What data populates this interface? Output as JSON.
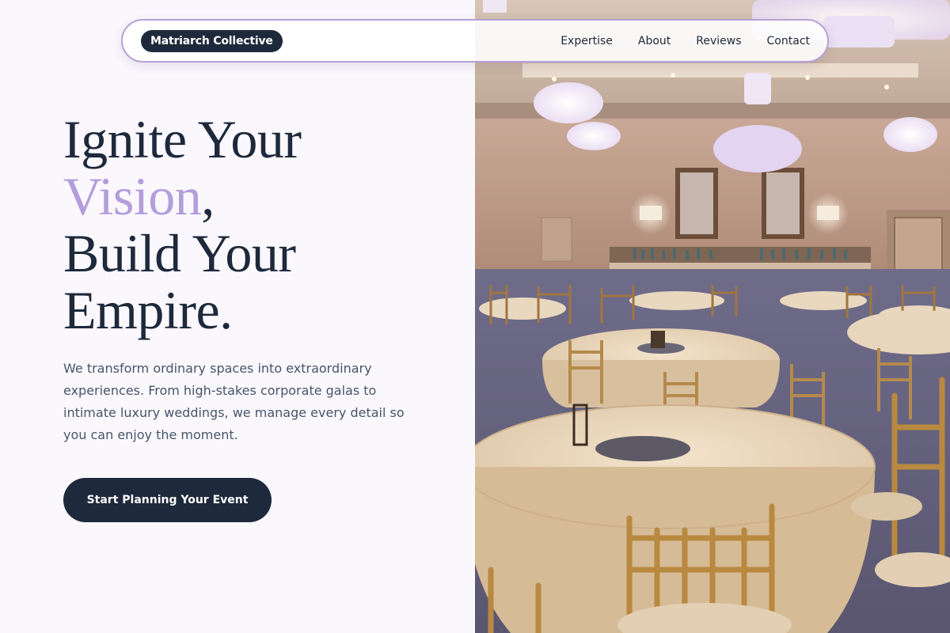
{
  "nav": {
    "brand": "Matriarch Collective",
    "links": [
      "Expertise",
      "About",
      "Reviews",
      "Contact"
    ]
  },
  "hero": {
    "headline_part1": "Ignite Your ",
    "headline_accent": "Vision",
    "headline_part2": ",",
    "headline_line2": "Build Your",
    "headline_line3": "Empire.",
    "lead": "We transform ordinary spaces into extraordinary experiences. From high-stakes corporate galas to intimate luxury weddings, we manage every detail so you can enjoy the moment.",
    "cta_label": "Start Planning Your Event"
  },
  "image": {
    "subject": "ballroom-banquet-photo"
  },
  "colors": {
    "navy": "#1e293b",
    "lavender_accent": "#b39ddb",
    "background": "#faf8fd",
    "nav_border": "#b7a1d6"
  }
}
